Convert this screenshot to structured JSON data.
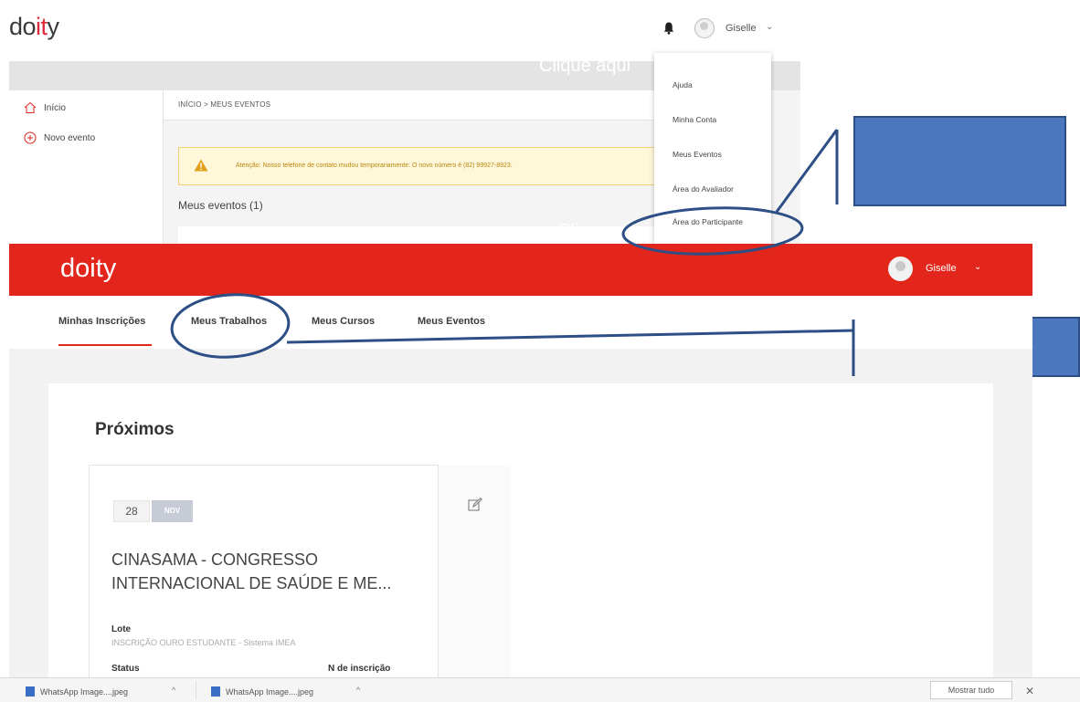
{
  "top_screenshot": {
    "logo": "doity",
    "logo_parts": [
      "do",
      "it",
      "y"
    ],
    "user_name": "Giselle",
    "clique_aqui": "Clique aqui",
    "sidebar": [
      {
        "label": "Início",
        "icon": "home-icon"
      },
      {
        "label": "Novo evento",
        "icon": "plus-circle-icon"
      }
    ],
    "breadcrumb": "INÍCIO > MEUS EVENTOS",
    "alert_text": "Atenção: Nosso telefone de contato mudou temporariamente. O novo número é (82) 99927-8923.",
    "meus_eventos_heading": "Meus eventos (1)",
    "dropdown": [
      "Ajuda",
      "Minha Conta",
      "Meus Eventos",
      "Área do Avaliador",
      "Área do Participante"
    ]
  },
  "bottom_screenshot": {
    "logo": "doity",
    "user_name": "Giselle",
    "clique_aqui": "Clique aqui",
    "tabs": [
      "Minhas Inscrições",
      "Meus Trabalhos",
      "Meus Cursos",
      "Meus Eventos"
    ],
    "active_tab": "Minhas Inscrições",
    "section_title": "Próximos",
    "event": {
      "day": "28",
      "month": "NOV",
      "title": "CINASAMA - CONGRESSO INTERNACIONAL DE SAÚDE E ME...",
      "lote_label": "Lote",
      "lote_value": "INSCRIÇÃO OURO ESTUDANTE - Sistema IMEA",
      "status_label": "Status",
      "inscricao_label": "N de inscrição"
    }
  },
  "download_bar": {
    "items": [
      "WhatsApp Image....jpeg",
      "WhatsApp Image....jpeg"
    ],
    "show_all": "Mostrar tudo",
    "close": "✕"
  },
  "colors": {
    "brand_red": "#e2261c",
    "callout_blue": "#4a77bd",
    "callout_border": "#2d4f86"
  }
}
